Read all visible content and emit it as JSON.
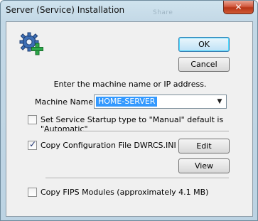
{
  "window": {
    "title": "Server (Service) Installation",
    "ghost_title": "Share",
    "close_glyph": "✕"
  },
  "icons": {
    "dialog_icon": "gear-plus-icon"
  },
  "buttons": {
    "ok": "OK",
    "cancel": "Cancel",
    "edit": "Edit",
    "view": "View"
  },
  "prompt": "Enter the machine name or IP address.",
  "machine": {
    "label": "Machine Name:",
    "value": "HOME-SERVER"
  },
  "options": {
    "startup_manual": {
      "label": "Set Service Startup type to \"Manual\" default is \"Automatic\"",
      "checked": false
    },
    "copy_config": {
      "label": "Copy Configuration File DWRCS.INI",
      "checked": true
    },
    "copy_fips": {
      "label": "Copy FIPS Modules (approximately 4.1 MB)",
      "checked": false
    }
  },
  "colors": {
    "selection": "#3399ff",
    "gear": "#3d6fb6",
    "plus": "#2ea84a"
  }
}
